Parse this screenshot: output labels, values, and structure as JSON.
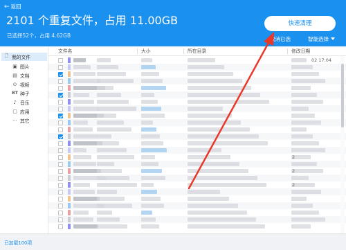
{
  "header": {
    "back_label": "返回",
    "title": "2101 个重复文件，占用 11.00GB",
    "selection_info": "已选择52个，占用 4.62GB",
    "quick_clean_label": "快速清理",
    "cancel_selection_label": "取消已选",
    "smart_select_label": "智能选择"
  },
  "sidebar": {
    "items": [
      {
        "label": "我的文件",
        "icon": "document-icon"
      },
      {
        "label": "图片",
        "icon": "image-icon"
      },
      {
        "label": "文档",
        "icon": "document-icon"
      },
      {
        "label": "视频",
        "icon": "play-icon"
      },
      {
        "label": "种子",
        "icon": "bt-icon"
      },
      {
        "label": "音乐",
        "icon": "music-note-icon"
      },
      {
        "label": "应用",
        "icon": "app-icon"
      },
      {
        "label": "其它",
        "icon": "more-icon"
      }
    ]
  },
  "table": {
    "columns": [
      "文件名",
      "大小",
      "所在目录",
      "修改日期"
    ],
    "visible_modified_text": "02 17:04",
    "visible_date_fragment": "2",
    "checked_rows": [
      2,
      5,
      8,
      11
    ]
  },
  "footer": {
    "status": "已加载100项"
  },
  "colors": {
    "accent": "#1a90ef",
    "arrow": "#e8382a"
  }
}
